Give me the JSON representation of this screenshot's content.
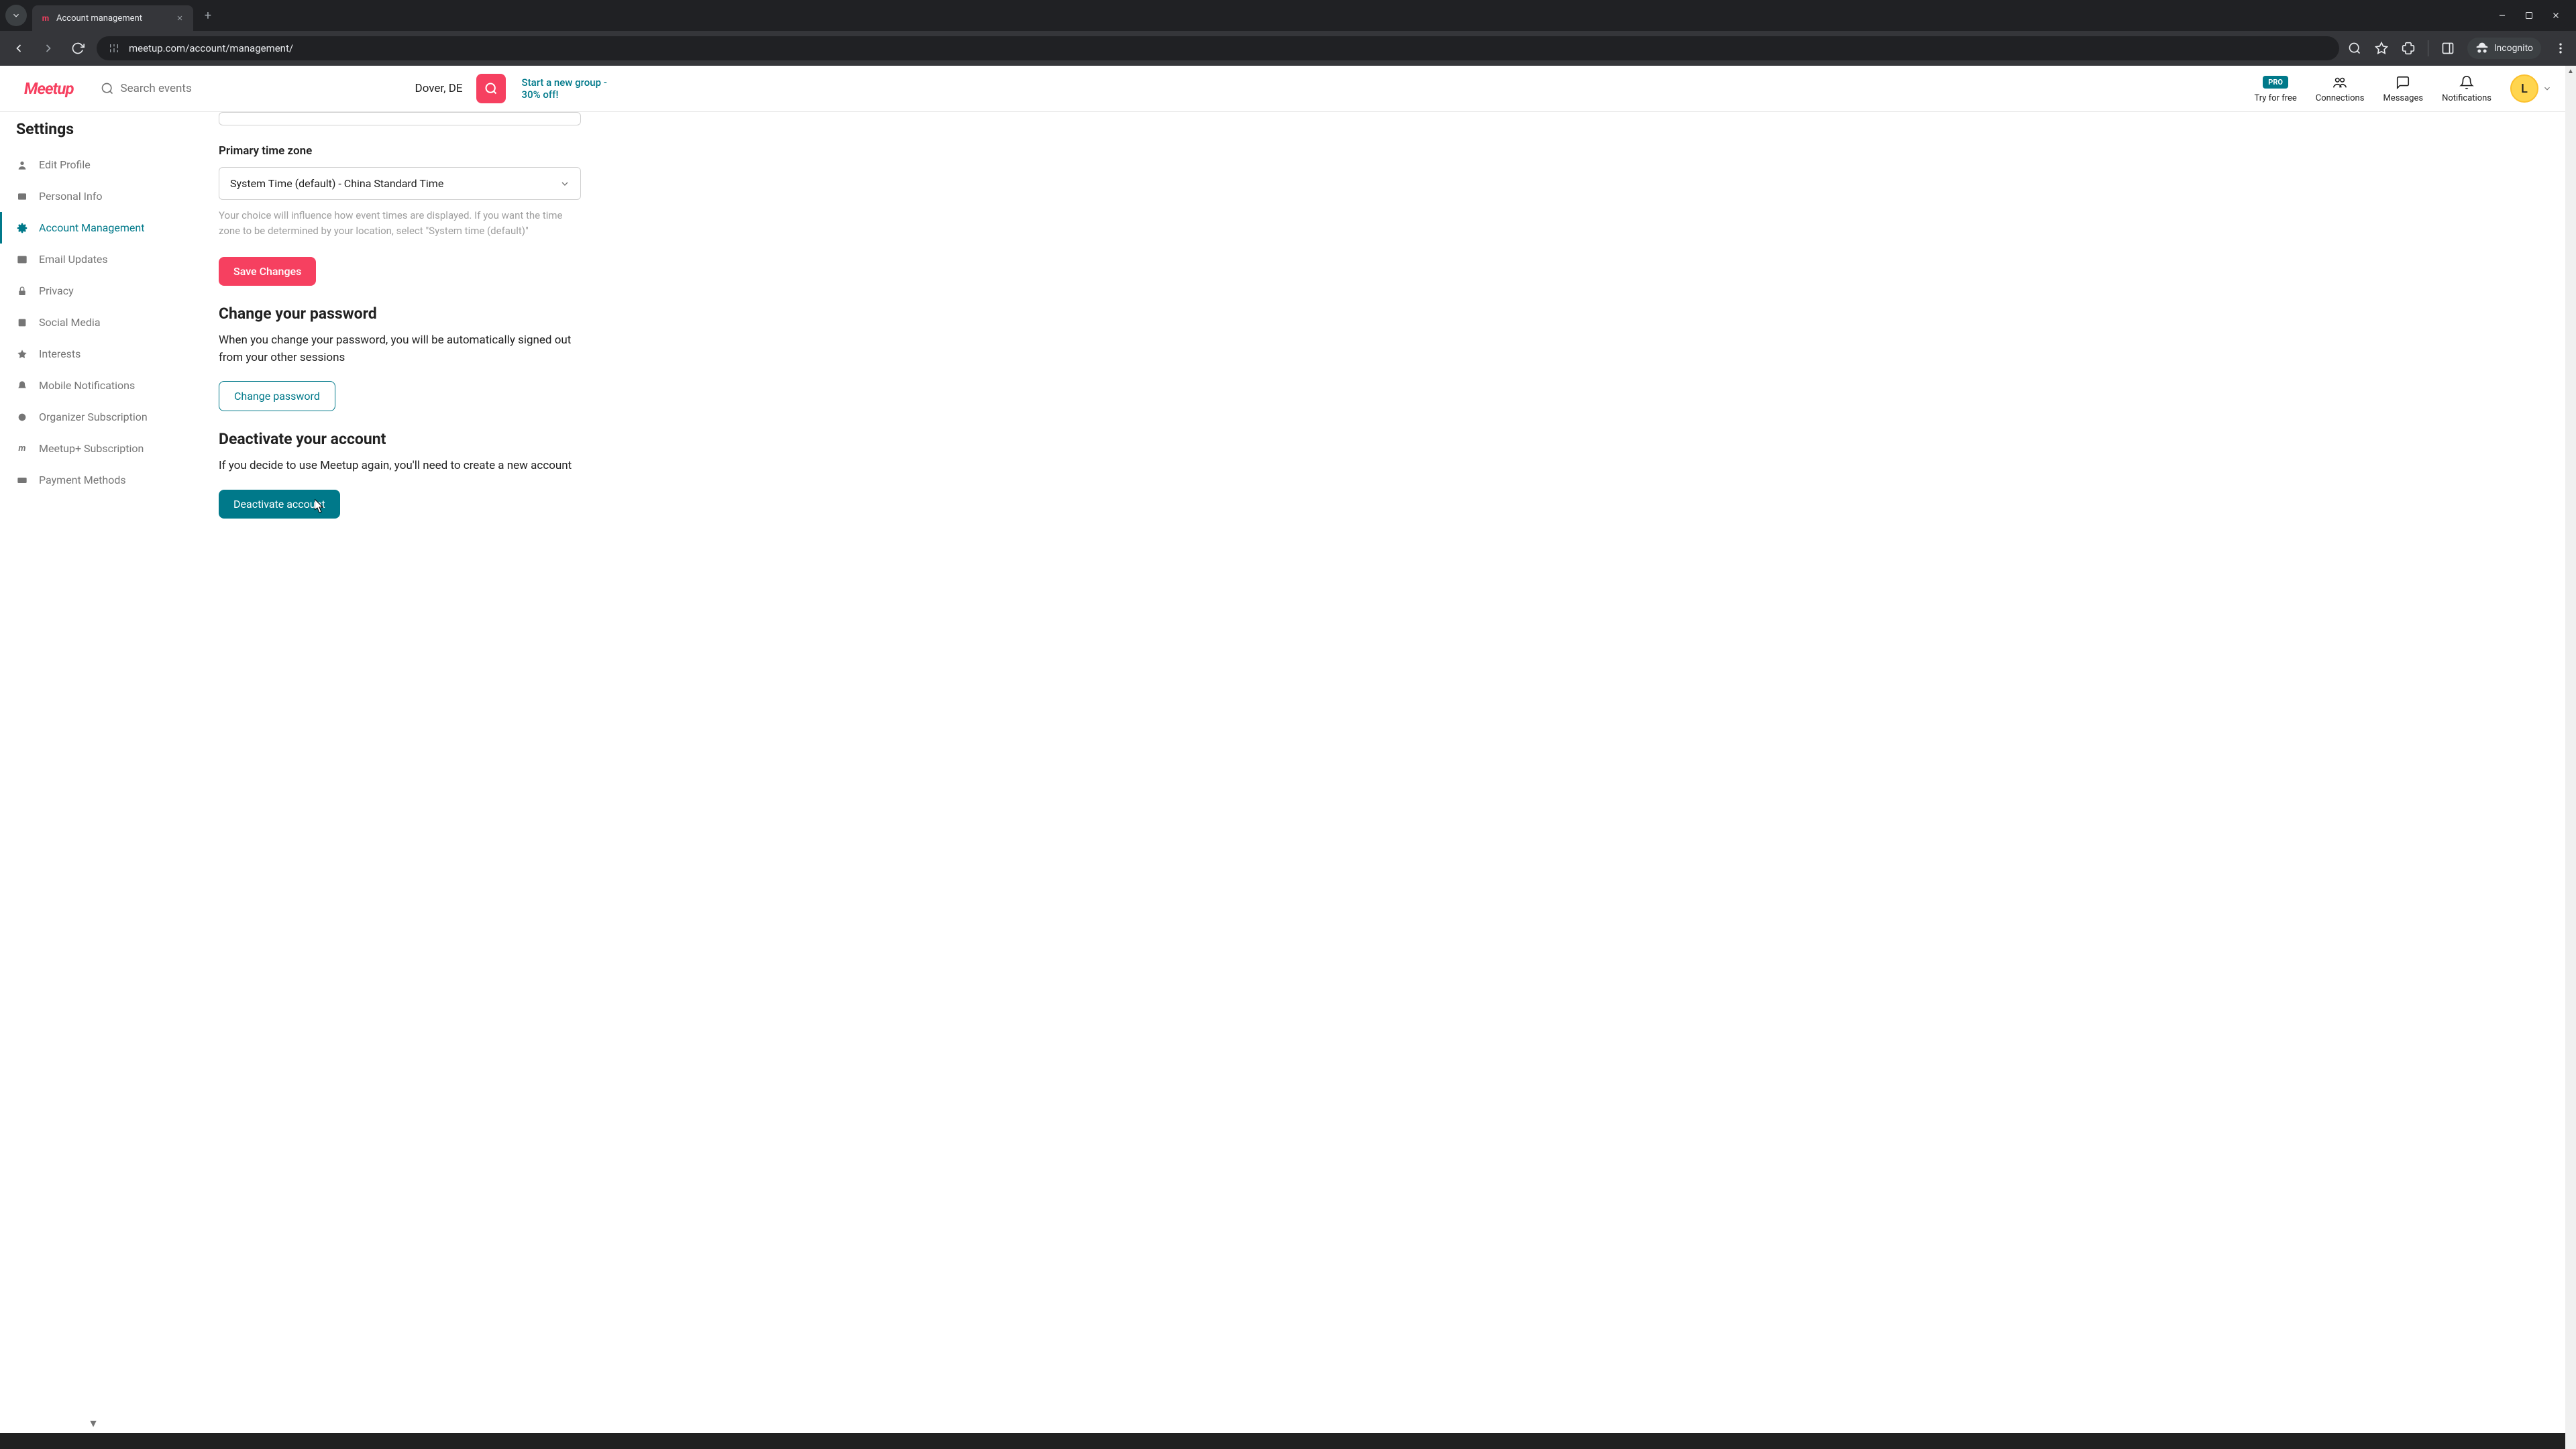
{
  "browser": {
    "tab_title": "Account management",
    "url": "meetup.com/account/management/",
    "incognito_label": "Incognito"
  },
  "header": {
    "logo": "Meetup",
    "search_placeholder": "Search events",
    "location": "Dover, DE",
    "promo": "Start a new group - 30% off!",
    "pro_badge": "PRO",
    "try_free": "Try for free",
    "connections": "Connections",
    "messages": "Messages",
    "notifications": "Notifications",
    "avatar_initial": "L"
  },
  "sidebar": {
    "title": "Settings",
    "items": [
      {
        "label": "Edit Profile",
        "active": false
      },
      {
        "label": "Personal Info",
        "active": false
      },
      {
        "label": "Account Management",
        "active": true
      },
      {
        "label": "Email Updates",
        "active": false
      },
      {
        "label": "Privacy",
        "active": false
      },
      {
        "label": "Social Media",
        "active": false
      },
      {
        "label": "Interests",
        "active": false
      },
      {
        "label": "Mobile Notifications",
        "active": false
      },
      {
        "label": "Organizer Subscription",
        "active": false
      },
      {
        "label": "Meetup+ Subscription",
        "active": false
      },
      {
        "label": "Payment Methods",
        "active": false
      }
    ]
  },
  "main": {
    "timezone": {
      "label": "Primary time zone",
      "value": "System Time (default) - China Standard Time",
      "helper": "Your choice will influence how event times are displayed. If you want the time zone to be determined by your location, select \"System time (default)\""
    },
    "save_button": "Save Changes",
    "password": {
      "heading": "Change your password",
      "desc": "When you change your password, you will be automatically signed out from your other sessions",
      "button": "Change password"
    },
    "deactivate": {
      "heading": "Deactivate your account",
      "desc": "If you decide to use Meetup again, you'll need to create a new account",
      "button": "Deactivate account"
    }
  }
}
